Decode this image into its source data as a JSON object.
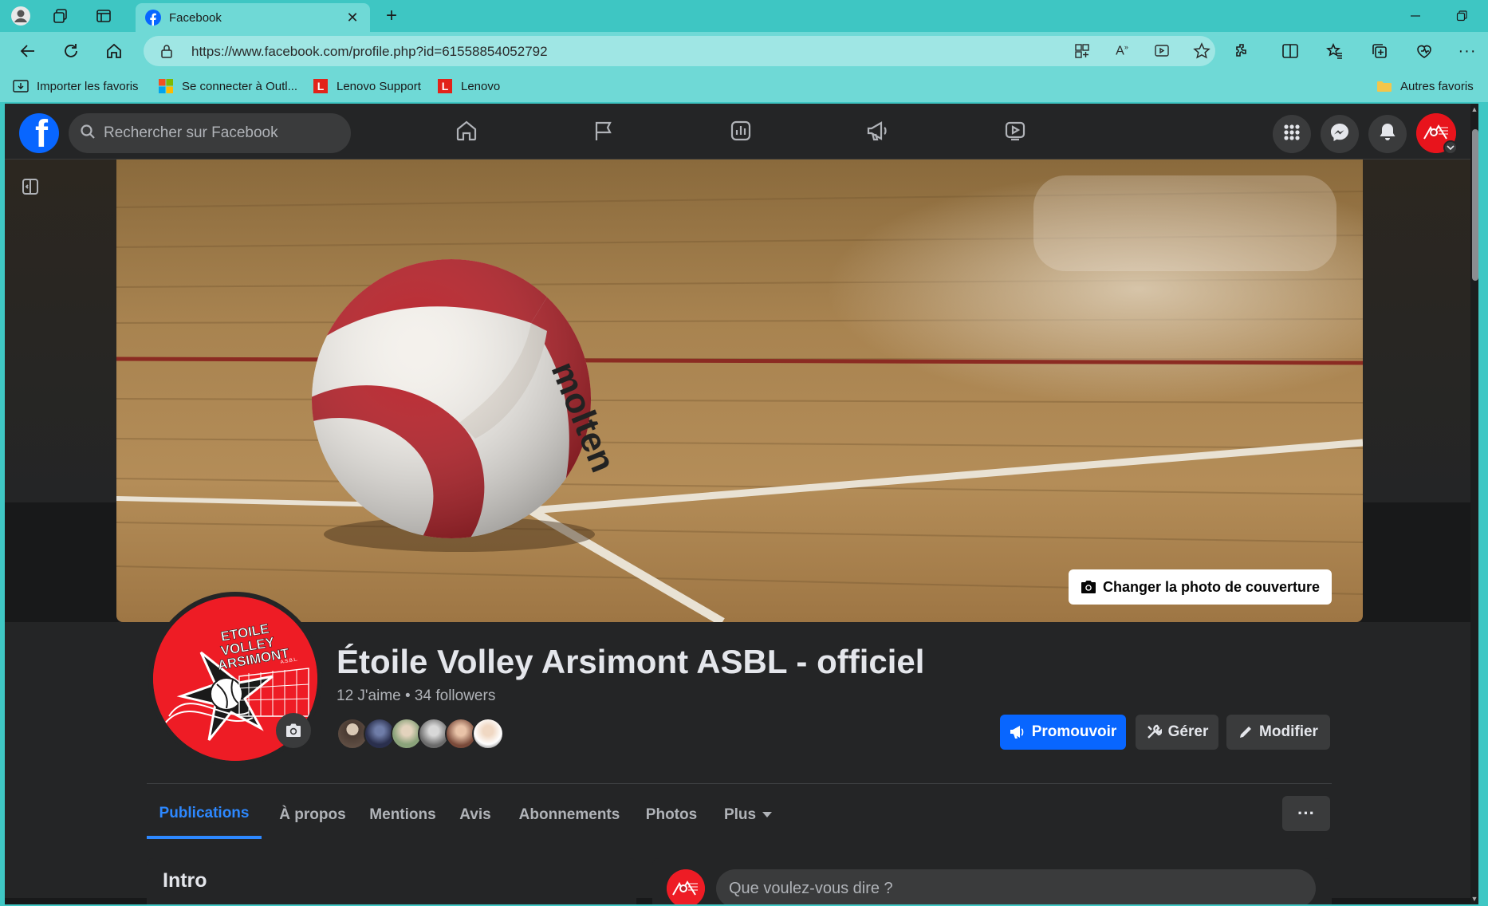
{
  "browser": {
    "tab_title": "Facebook",
    "url": "https://www.facebook.com/profile.php?id=61558854052792",
    "favorites": [
      {
        "label": "Importer les favoris",
        "icon": "import-icon"
      },
      {
        "label": "Se connecter à Outl...",
        "icon": "microsoft-icon"
      },
      {
        "label": "Lenovo Support",
        "icon": "lenovo-icon"
      },
      {
        "label": "Lenovo",
        "icon": "lenovo-icon"
      }
    ],
    "other_favorites": "Autres favoris"
  },
  "header": {
    "search_placeholder": "Rechercher sur Facebook",
    "nav_icons": [
      "home-icon",
      "flag-icon",
      "insights-icon",
      "megaphone-icon",
      "video-icon"
    ],
    "right_icons": [
      "menu-grid-icon",
      "messenger-icon",
      "bell-icon"
    ]
  },
  "cover": {
    "change_button": "Changer la photo de couverture"
  },
  "profile": {
    "name": "Étoile Volley Arsimont ASBL - officiel",
    "stats": "12 J'aime • 34 followers",
    "logo_text": [
      "ETOILE",
      "VOLLEY",
      "ARSIMONT",
      "A.S.B.L."
    ]
  },
  "actions": {
    "promote": "Promouvoir",
    "manage": "Gérer",
    "edit": "Modifier"
  },
  "tabs": [
    {
      "label": "Publications",
      "active": true
    },
    {
      "label": "À propos",
      "active": false
    },
    {
      "label": "Mentions",
      "active": false
    },
    {
      "label": "Avis",
      "active": false
    },
    {
      "label": "Abonnements",
      "active": false
    },
    {
      "label": "Photos",
      "active": false
    },
    {
      "label": "Plus",
      "active": false
    }
  ],
  "intro": {
    "title": "Intro"
  },
  "composer": {
    "placeholder": "Que voulez-vous dire ?"
  },
  "colors": {
    "browser_accent": "#3ec6c3",
    "fb_blue": "#0866ff",
    "fb_dark_bg": "#18191a",
    "fb_surface": "#242526",
    "club_red": "#ee1c25"
  }
}
